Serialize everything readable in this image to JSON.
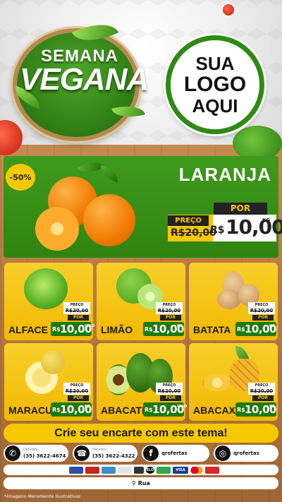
{
  "header": {
    "badge_line1": "SEMANA",
    "badge_line2": "VEGANA",
    "logo_lines": [
      "SUA",
      "LOGO",
      "AQUI"
    ]
  },
  "featured": {
    "discount": "-50%",
    "name": "LARANJA",
    "preco_label": "PREÇO",
    "por_label": "POR",
    "old_price": "R$20,00",
    "currency": "R$",
    "price": "10,00",
    "unit": "KG"
  },
  "products": [
    {
      "name": "ALFACE",
      "preco_label": "PREÇO",
      "old_price": "R$20,00",
      "por_label": "POR",
      "currency": "R$",
      "price": "10,00",
      "unit": "UNID"
    },
    {
      "name": "LIMÃO",
      "preco_label": "PREÇO",
      "old_price": "R$20,00",
      "por_label": "POR",
      "currency": "R$",
      "price": "10,00",
      "unit": "KG"
    },
    {
      "name": "BATATA",
      "preco_label": "PREÇO",
      "old_price": "R$20,00",
      "por_label": "POR",
      "currency": "R$",
      "price": "10,00",
      "unit": "KG"
    },
    {
      "name": "MARACUJÁ",
      "preco_label": "PREÇO",
      "old_price": "R$20,00",
      "por_label": "POR",
      "currency": "R$",
      "price": "10,00",
      "unit": "KG"
    },
    {
      "name": "ABACATE",
      "preco_label": "PREÇO",
      "old_price": "R$20,00",
      "por_label": "POR",
      "currency": "R$",
      "price": "10,00",
      "unit": "UNID"
    },
    {
      "name": "ABACAXI",
      "preco_label": "PREÇO",
      "old_price": "R$20,00",
      "por_label": "POR",
      "currency": "R$",
      "price": "10,00",
      "unit": "KG"
    }
  ],
  "banner": "Crie seu encarte com este tema!",
  "contacts": {
    "whatsapp": {
      "label": "Delivery",
      "value": "(35) 3622-4674"
    },
    "phone": {
      "label": "Delivery",
      "value": "(35) 3622-4322"
    },
    "facebook": {
      "value": "qrofertas"
    },
    "instagram": {
      "value": "qrofertas"
    }
  },
  "payments": [
    "ELO",
    "",
    "",
    "VISA",
    "",
    ""
  ],
  "address": "Rua",
  "footnote": "*Imagens Meramente Ilustrativas",
  "colors": {
    "green": "#2f8410",
    "yellow": "#f6c800",
    "dark": "#222222"
  }
}
